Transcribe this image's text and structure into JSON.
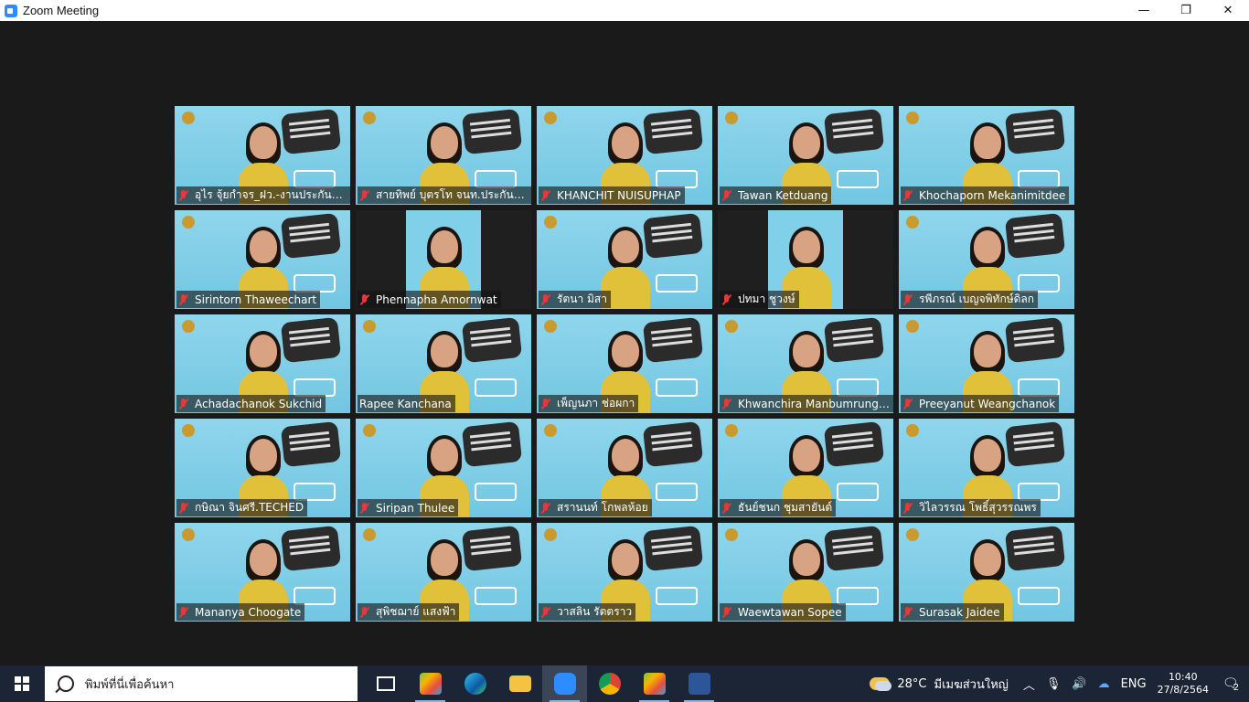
{
  "window": {
    "title": "Zoom Meeting",
    "buttons": [
      "—",
      "❐",
      "✕"
    ]
  },
  "participants": [
    {
      "name": "อุไร จุ้ยกำจร_ฝว.-งานประกันคุณ...",
      "muted": true,
      "active": false
    },
    {
      "name": "สายทิพย์ บุตรโท จนท.ประกัน คอ.",
      "muted": true,
      "active": true
    },
    {
      "name": "KHANCHIT NUISUPHAP",
      "muted": true,
      "active": false
    },
    {
      "name": "Tawan Ketduang",
      "muted": true,
      "active": false
    },
    {
      "name": "Khochaporn Mekanimitdee",
      "muted": true,
      "active": false
    },
    {
      "name": "Sirintorn Thaweechart",
      "muted": true,
      "active": false
    },
    {
      "name": "Phennapha Amornwat",
      "muted": true,
      "active": false
    },
    {
      "name": "รัตนา มิสา",
      "muted": true,
      "active": false
    },
    {
      "name": "ปทมา ชูวงษ์",
      "muted": true,
      "active": false
    },
    {
      "name": "รพีภรณ์ เบญจพิทักษ์ดิลก",
      "muted": true,
      "active": false
    },
    {
      "name": "Achadachanok Sukchid",
      "muted": true,
      "active": false
    },
    {
      "name": "Rapee Kanchana",
      "muted": false,
      "active": false
    },
    {
      "name": "เพ็ญนภา ช่อผกา",
      "muted": true,
      "active": false
    },
    {
      "name": "Khwanchira Manbumrungsat",
      "muted": true,
      "active": false
    },
    {
      "name": "Preeyanut Weangchanok",
      "muted": true,
      "active": false
    },
    {
      "name": "กษิณา จินศรี.TECHED",
      "muted": true,
      "active": false
    },
    {
      "name": "Siripan Thulee",
      "muted": true,
      "active": false
    },
    {
      "name": "สรานนท์ โกพลห้อย",
      "muted": true,
      "active": false
    },
    {
      "name": "ธันย์ชนก ชุมสายันต์",
      "muted": true,
      "active": false
    },
    {
      "name": "วิไลวรรณ โพธิ์สุวรรณพร",
      "muted": true,
      "active": false
    },
    {
      "name": "Mananya Choogate",
      "muted": true,
      "active": false
    },
    {
      "name": "สุพิชฌาย์ แสงฟ้า",
      "muted": true,
      "active": false
    },
    {
      "name": "วาสลิน รัตตราว",
      "muted": true,
      "active": false
    },
    {
      "name": "Waewtawan Sopee",
      "muted": true,
      "active": false
    },
    {
      "name": "Surasak Jaidee",
      "muted": true,
      "active": false
    }
  ],
  "taskbar": {
    "search_placeholder": "พิมพ์ที่นี่เพื่อค้นหา",
    "apps": [
      "task-view",
      "bluestacks",
      "edge",
      "file-explorer",
      "zoom",
      "chrome",
      "bluestacks-2",
      "word"
    ],
    "weather_temp": "28°C",
    "weather_text": "มีเมฆส่วนใหญ่",
    "language": "ENG",
    "time": "10:40",
    "date": "27/8/2564",
    "notification_count": "2"
  }
}
